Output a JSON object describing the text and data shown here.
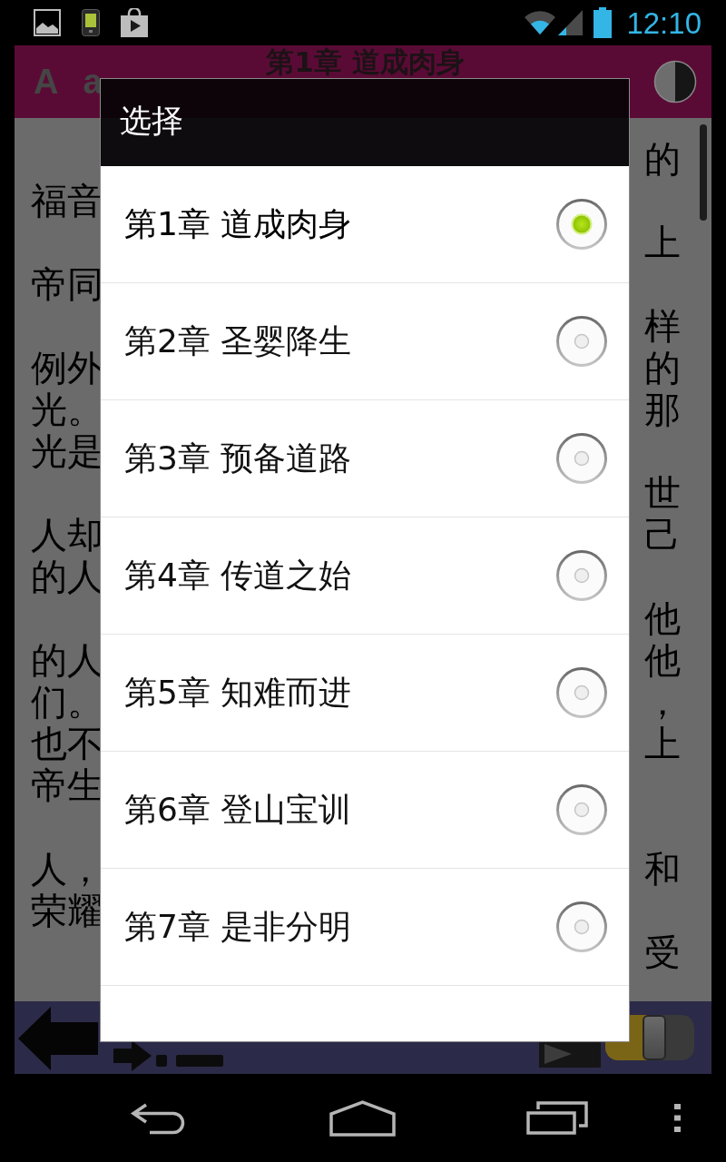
{
  "status_bar": {
    "time": "12:10"
  },
  "header": {
    "font_buttons": [
      "A",
      "a"
    ],
    "title": "第1章 道成肉身"
  },
  "body": {
    "lines": [
      {
        "kind": "text",
        "right": "的"
      },
      {
        "kind": "text",
        "left": "福音"
      },
      {
        "kind": "text",
        "right": "上"
      },
      {
        "kind": "text",
        "left": "帝同"
      },
      {
        "kind": "text",
        "right": "样"
      },
      {
        "kind": "text",
        "left": "例外",
        "right": "的"
      },
      {
        "kind": "text",
        "left": "光。",
        "right": "那"
      },
      {
        "kind": "text",
        "left": "光是"
      },
      {
        "kind": "text",
        "right": "世"
      },
      {
        "kind": "text",
        "left": "人却",
        "right": "己"
      },
      {
        "kind": "text",
        "left": "的人"
      },
      {
        "kind": "text",
        "right": "他"
      },
      {
        "kind": "text",
        "left": "的人",
        "right": "他"
      },
      {
        "kind": "text",
        "left": "们。",
        "right": "，"
      },
      {
        "kind": "text",
        "left": "也不",
        "right": "上"
      },
      {
        "kind": "text",
        "left": "帝生"
      },
      {
        "kind": "blank"
      },
      {
        "kind": "text",
        "left": "人，",
        "right": "和"
      },
      {
        "kind": "text",
        "left": "荣耀"
      },
      {
        "kind": "text",
        "right": "受"
      }
    ]
  },
  "toolbar": {
    "slider": {
      "level": 0.55
    }
  },
  "dialog": {
    "title": "选择",
    "options": [
      {
        "label": "第1章 道成肉身",
        "selected": true
      },
      {
        "label": "第2章 圣婴降生",
        "selected": false
      },
      {
        "label": "第3章 预备道路",
        "selected": false
      },
      {
        "label": "第4章 传道之始",
        "selected": false
      },
      {
        "label": "第5章 知难而进",
        "selected": false
      },
      {
        "label": "第6章 登山宝训",
        "selected": false
      },
      {
        "label": "第7章 是非分明",
        "selected": false
      }
    ]
  }
}
